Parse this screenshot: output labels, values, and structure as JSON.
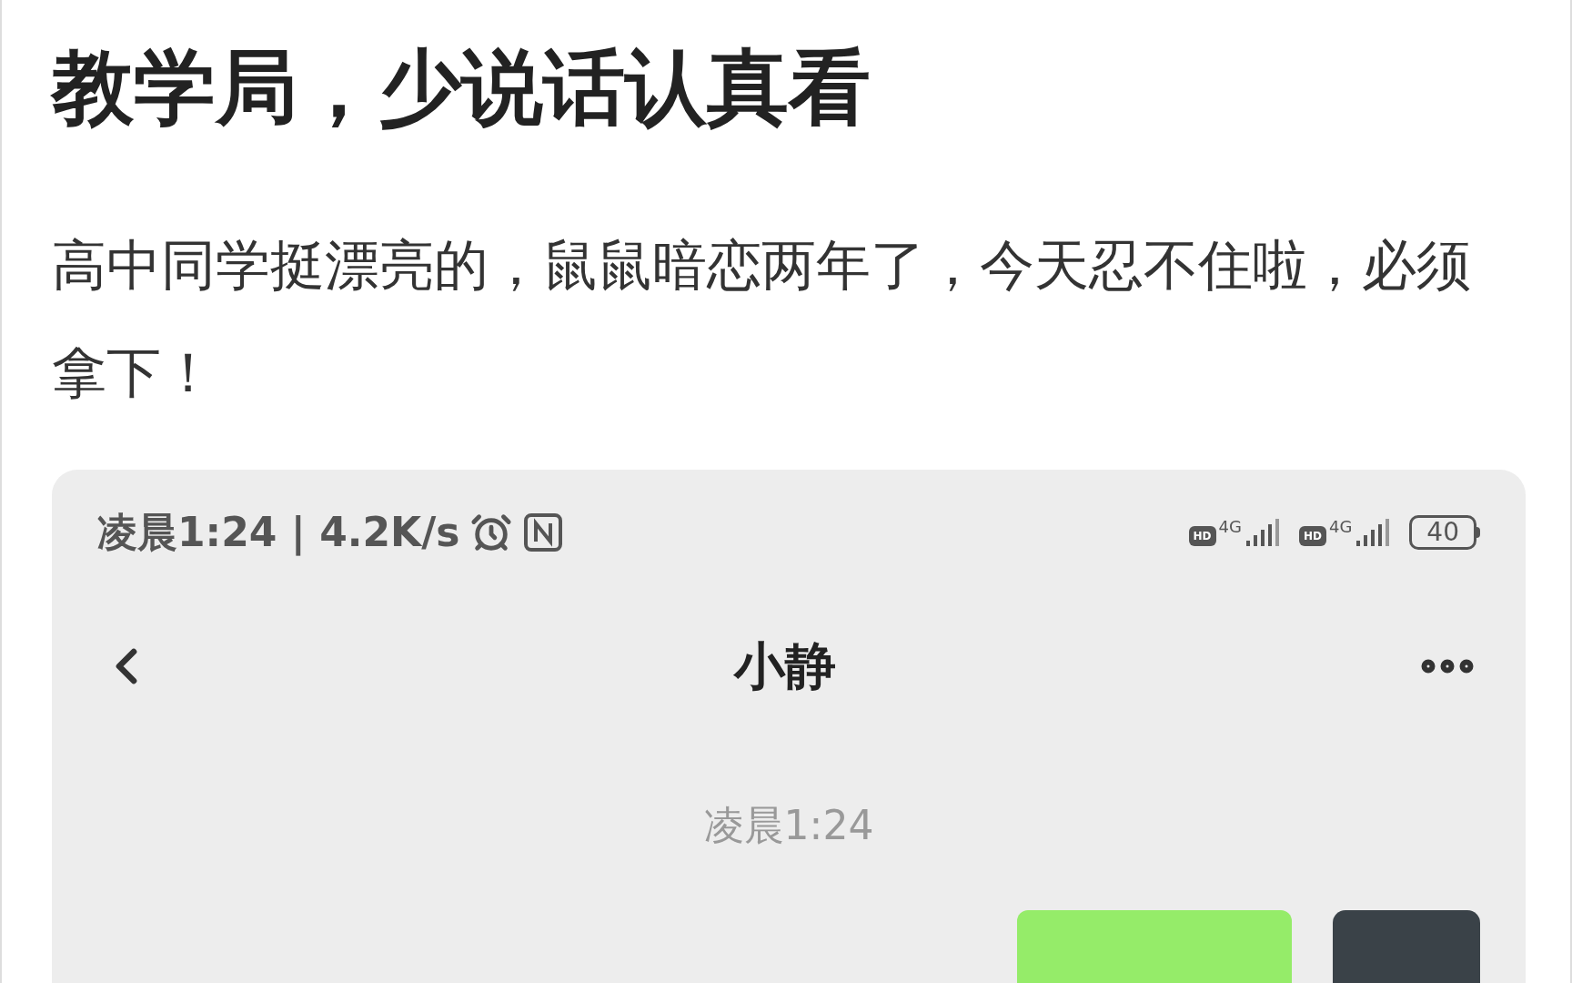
{
  "post": {
    "title": "教学局，少说话认真看",
    "body": "高中同学挺漂亮的，鼠鼠暗恋两年了，今天忍不住啦，必须拿下！"
  },
  "screenshot": {
    "status_bar": {
      "time_and_speed": "凌晨1:24 | 4.2K/s",
      "hd_1": "HD",
      "network_1": "4G",
      "hd_2": "HD",
      "network_2": "4G",
      "battery": "40"
    },
    "chat_header": {
      "contact": "小静"
    },
    "messages": [
      {
        "kind": "timestamp",
        "text": "凌晨1:24"
      },
      {
        "kind": "outgoing"
      }
    ]
  }
}
